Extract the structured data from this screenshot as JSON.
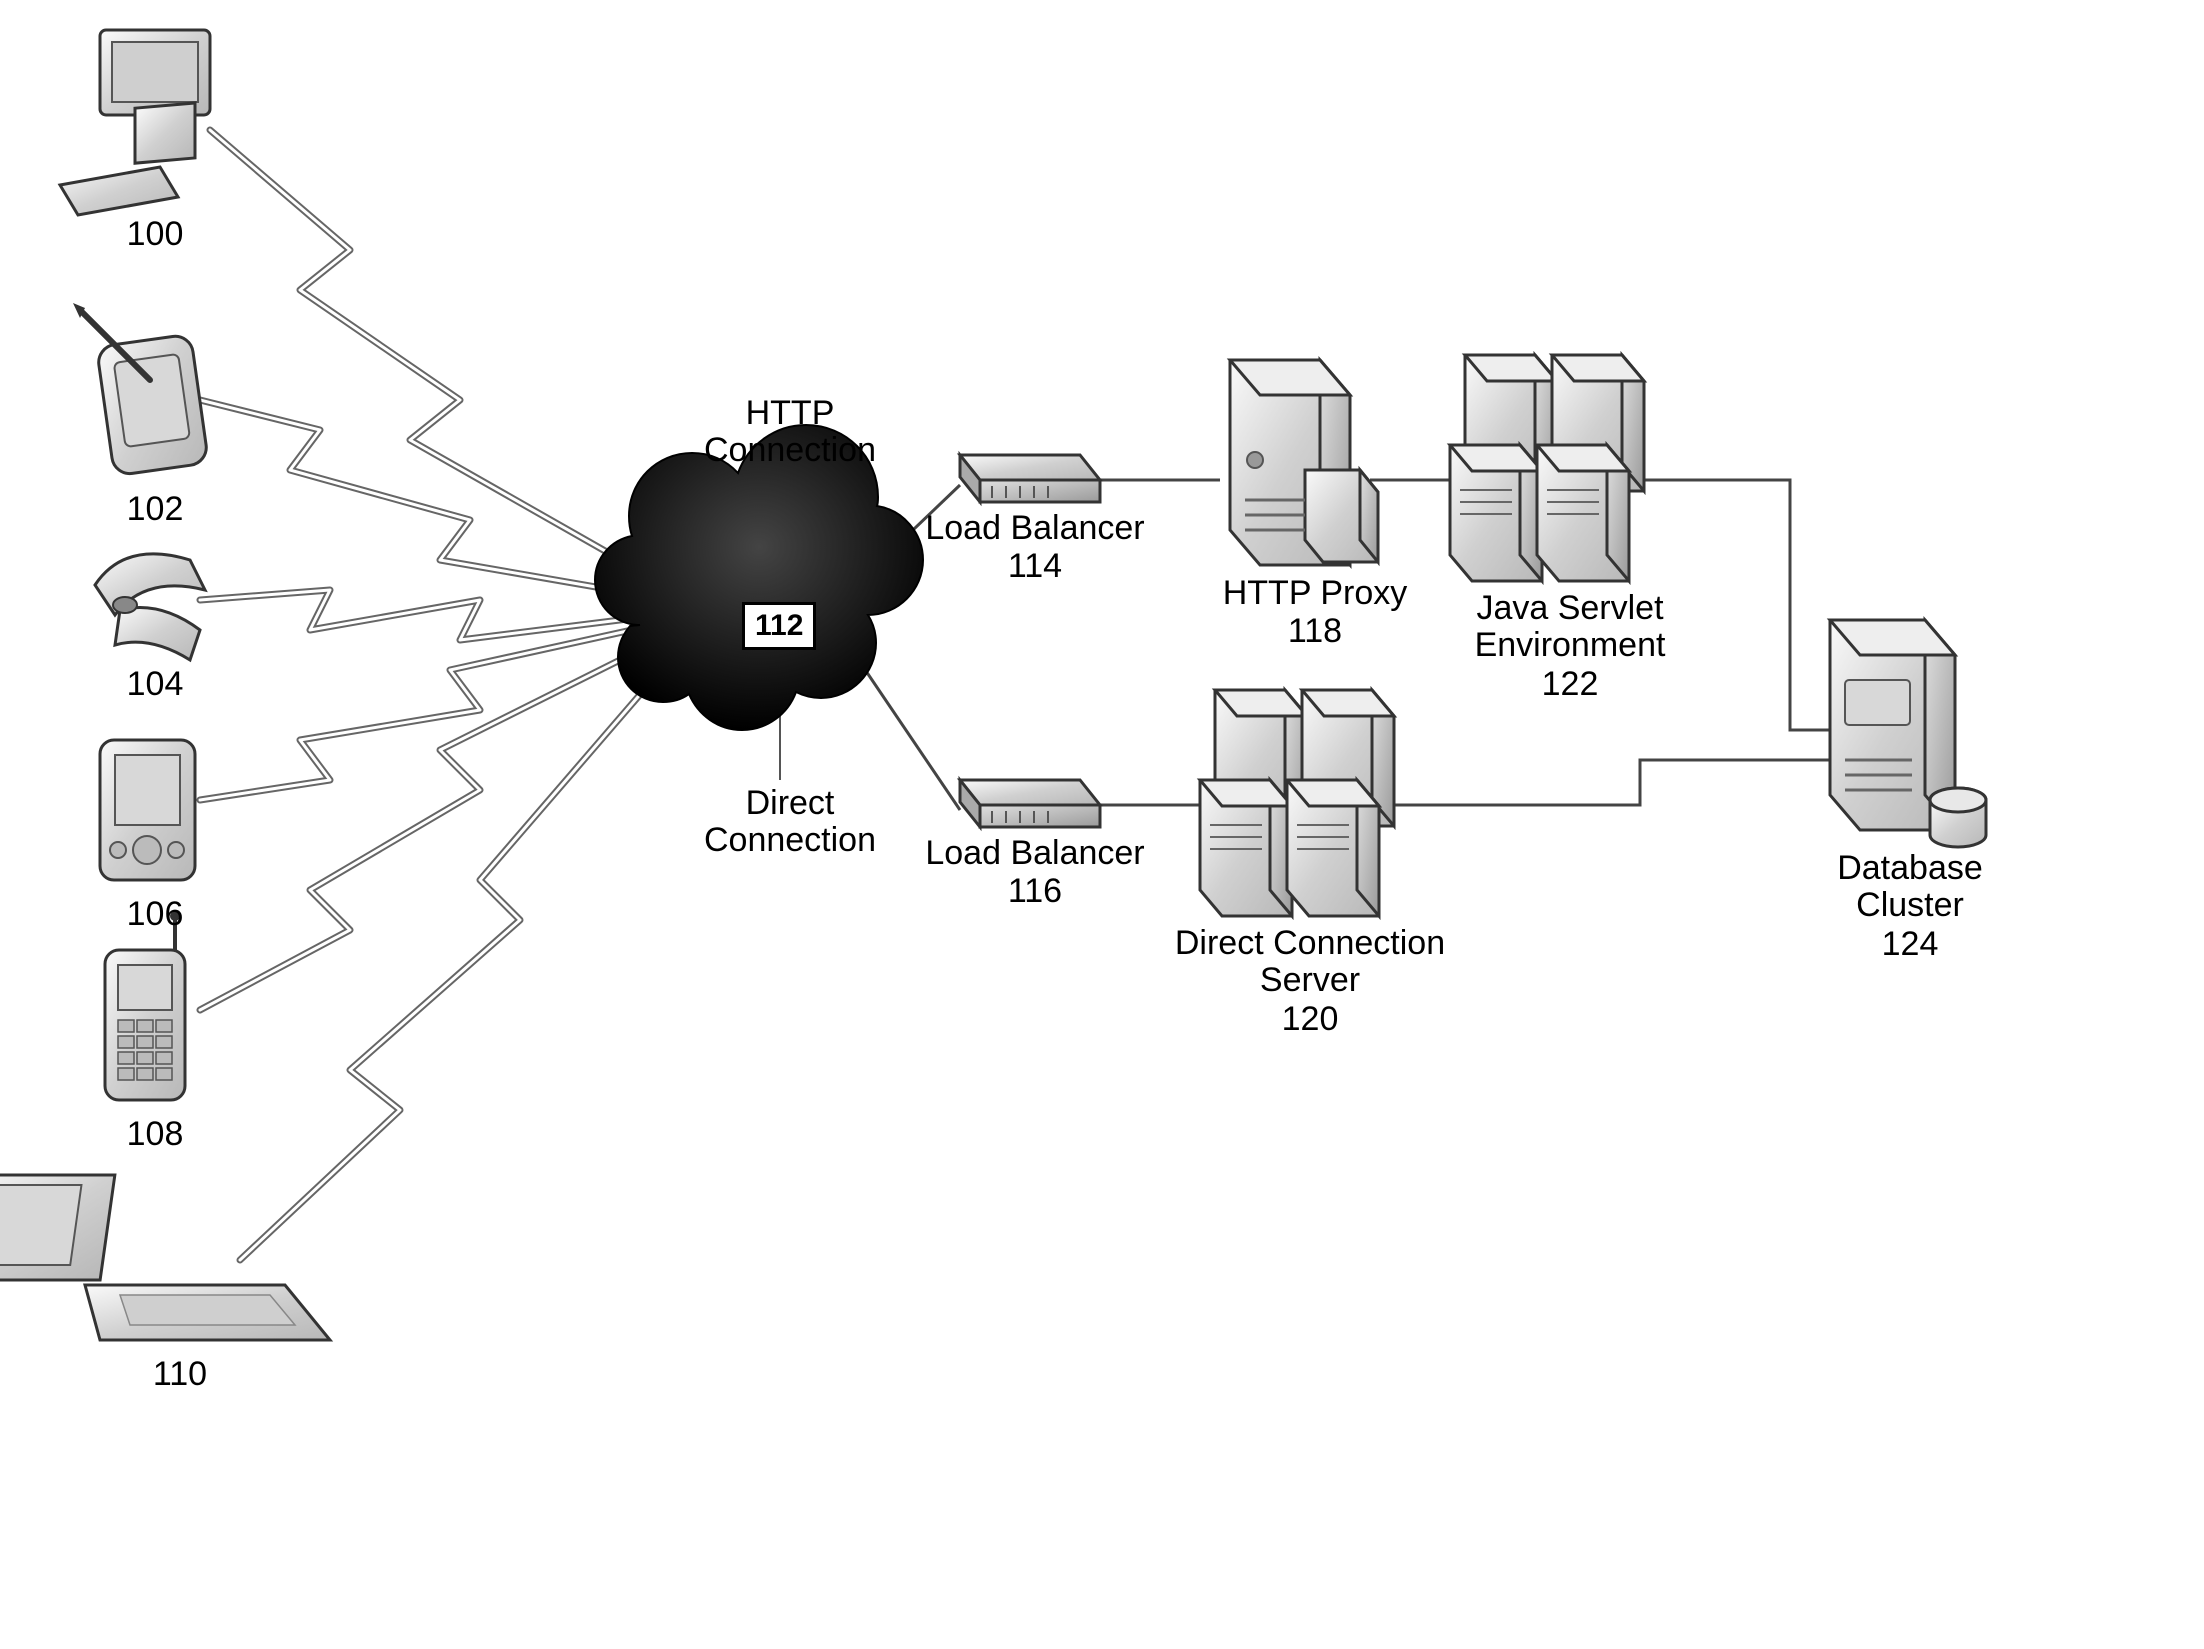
{
  "clients": {
    "desktop": {
      "ref": "100"
    },
    "tablet": {
      "ref": "102"
    },
    "flip": {
      "ref": "104"
    },
    "pda": {
      "ref": "106"
    },
    "phone": {
      "ref": "108"
    },
    "laptop": {
      "ref": "110"
    }
  },
  "cloud": {
    "ref": "112"
  },
  "paths": {
    "http": {
      "label": "HTTP\nConnection"
    },
    "direct": {
      "label": "Direct\nConnection"
    }
  },
  "lb": {
    "top": {
      "label": "Load Balancer",
      "ref": "114"
    },
    "bottom": {
      "label": "Load Balancer",
      "ref": "116"
    }
  },
  "proxy": {
    "http": {
      "label": "HTTP Proxy",
      "ref": "118"
    },
    "direct": {
      "label": "Direct Connection\nServer",
      "ref": "120"
    }
  },
  "servlet": {
    "label": "Java Servlet\nEnvironment",
    "ref": "122"
  },
  "db": {
    "label": "Database\nCluster",
    "ref": "124"
  }
}
